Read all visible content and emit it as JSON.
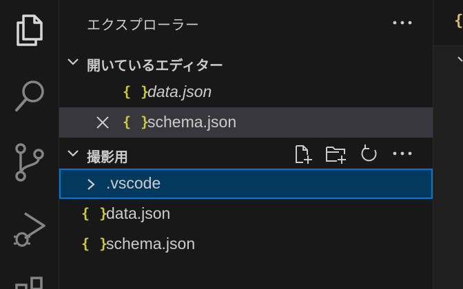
{
  "explorer": {
    "title": "エクスプローラー",
    "more_label": "···"
  },
  "open_editors": {
    "title": "開いているエディター",
    "files": [
      {
        "name": "data.json",
        "icon": "json-braces-icon",
        "label": "{ }"
      },
      {
        "name": "schema.json",
        "icon": "json-braces-icon",
        "label": "{ }"
      }
    ]
  },
  "workspace": {
    "title": "撮影用",
    "more_label": "···",
    "items": [
      {
        "name": ".vscode",
        "type": "folder"
      },
      {
        "name": "data.json",
        "type": "file",
        "label": "{ }"
      },
      {
        "name": "schema.json",
        "type": "file",
        "label": "{ }"
      }
    ]
  },
  "editor": {
    "tab_icon_label": "{"
  },
  "colors": {
    "background": "#181818",
    "selection": "#04395e",
    "focus_border": "#0078d4",
    "json_icon": "#cbcb41",
    "active_row": "#37373d"
  }
}
